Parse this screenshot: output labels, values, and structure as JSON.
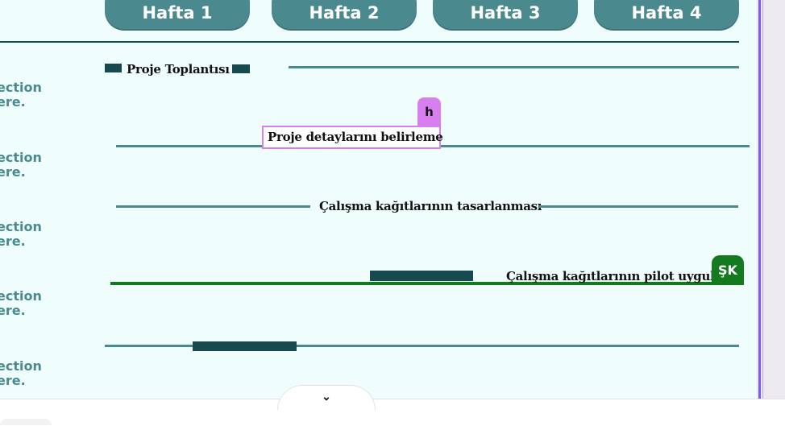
{
  "weeks": [
    "Hafta 1",
    "Hafta 2",
    "Hafta 3",
    "Hafta 4"
  ],
  "left_labels": [
    [
      "ection",
      "ere."
    ],
    [
      "ection",
      "ere."
    ],
    [
      "ection",
      "ere."
    ],
    [
      "ection",
      "ere."
    ],
    [
      "ection",
      "ere."
    ]
  ],
  "tasks": {
    "t1": "Proje Toplantısı",
    "t2": "Proje detaylarını belirleme",
    "t3": "Çalışma kağıtlarının tasarlanması",
    "t4": "Çalışma kağıtlarının pilot uygula"
  },
  "collaborators": {
    "h": {
      "initial": "h",
      "color": "#d87ff0"
    },
    "sk": {
      "initial": "ŞK",
      "color": "#137b1e"
    }
  },
  "colors": {
    "teal": "#4a8a8e",
    "dark_teal": "#164a4e",
    "canvas_bg": "#effefd",
    "selection_green": "#137b1e"
  },
  "pager": {
    "icon": "chevron-down-icon",
    "glyph": "⌄"
  }
}
